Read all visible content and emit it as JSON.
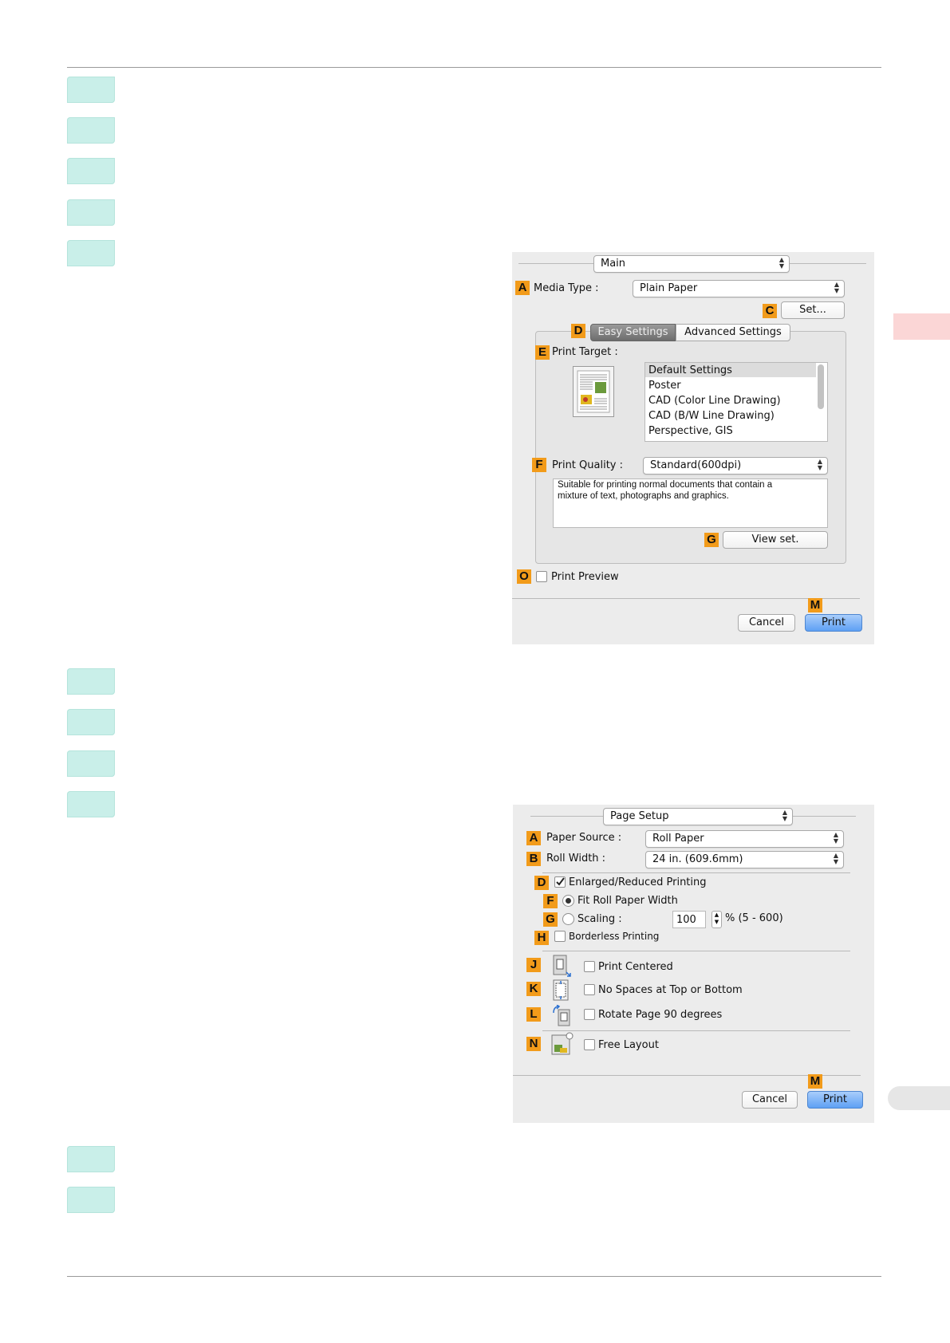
{
  "dialog1": {
    "panel_select": "Main",
    "media_type_label": "Media Type :",
    "media_type_value": "Plain Paper",
    "set_button": "Set...",
    "tab_easy": "Easy Settings",
    "tab_advanced": "Advanced Settings",
    "print_target_label": "Print Target :",
    "print_target_items": [
      "Default Settings",
      "Poster",
      "CAD (Color Line Drawing)",
      "CAD (B/W Line Drawing)",
      "Perspective, GIS"
    ],
    "print_quality_label": "Print Quality :",
    "print_quality_value": "Standard(600dpi)",
    "description_line1": "Suitable for printing normal documents that contain a",
    "description_line2": "mixture of text, photographs and graphics.",
    "view_set_button": "View set.",
    "print_preview_label": "Print Preview",
    "cancel_button": "Cancel",
    "print_button": "Print",
    "badges": {
      "a": "A",
      "c": "C",
      "d": "D",
      "e": "E",
      "f": "F",
      "g": "G",
      "o": "O",
      "m": "M"
    }
  },
  "dialog2": {
    "panel_select": "Page Setup",
    "paper_source_label": "Paper Source :",
    "paper_source_value": "Roll Paper",
    "roll_width_label": "Roll Width :",
    "roll_width_value": "24 in. (609.6mm)",
    "enlarged_label": "Enlarged/Reduced Printing",
    "fit_roll_label": "Fit Roll Paper Width",
    "scaling_label": "Scaling :",
    "scaling_value": "100",
    "scaling_range": "% (5 - 600)",
    "borderless_label": "Borderless Printing",
    "print_centered_label": "Print Centered",
    "no_spaces_label": "No Spaces at Top or Bottom",
    "rotate_label": "Rotate Page 90 degrees",
    "free_layout_label": "Free Layout",
    "cancel_button": "Cancel",
    "print_button": "Print",
    "badges": {
      "a": "A",
      "b": "B",
      "d": "D",
      "f": "F",
      "g": "G",
      "h": "H",
      "j": "J",
      "k": "K",
      "l": "L",
      "n": "N",
      "m": "M"
    }
  }
}
